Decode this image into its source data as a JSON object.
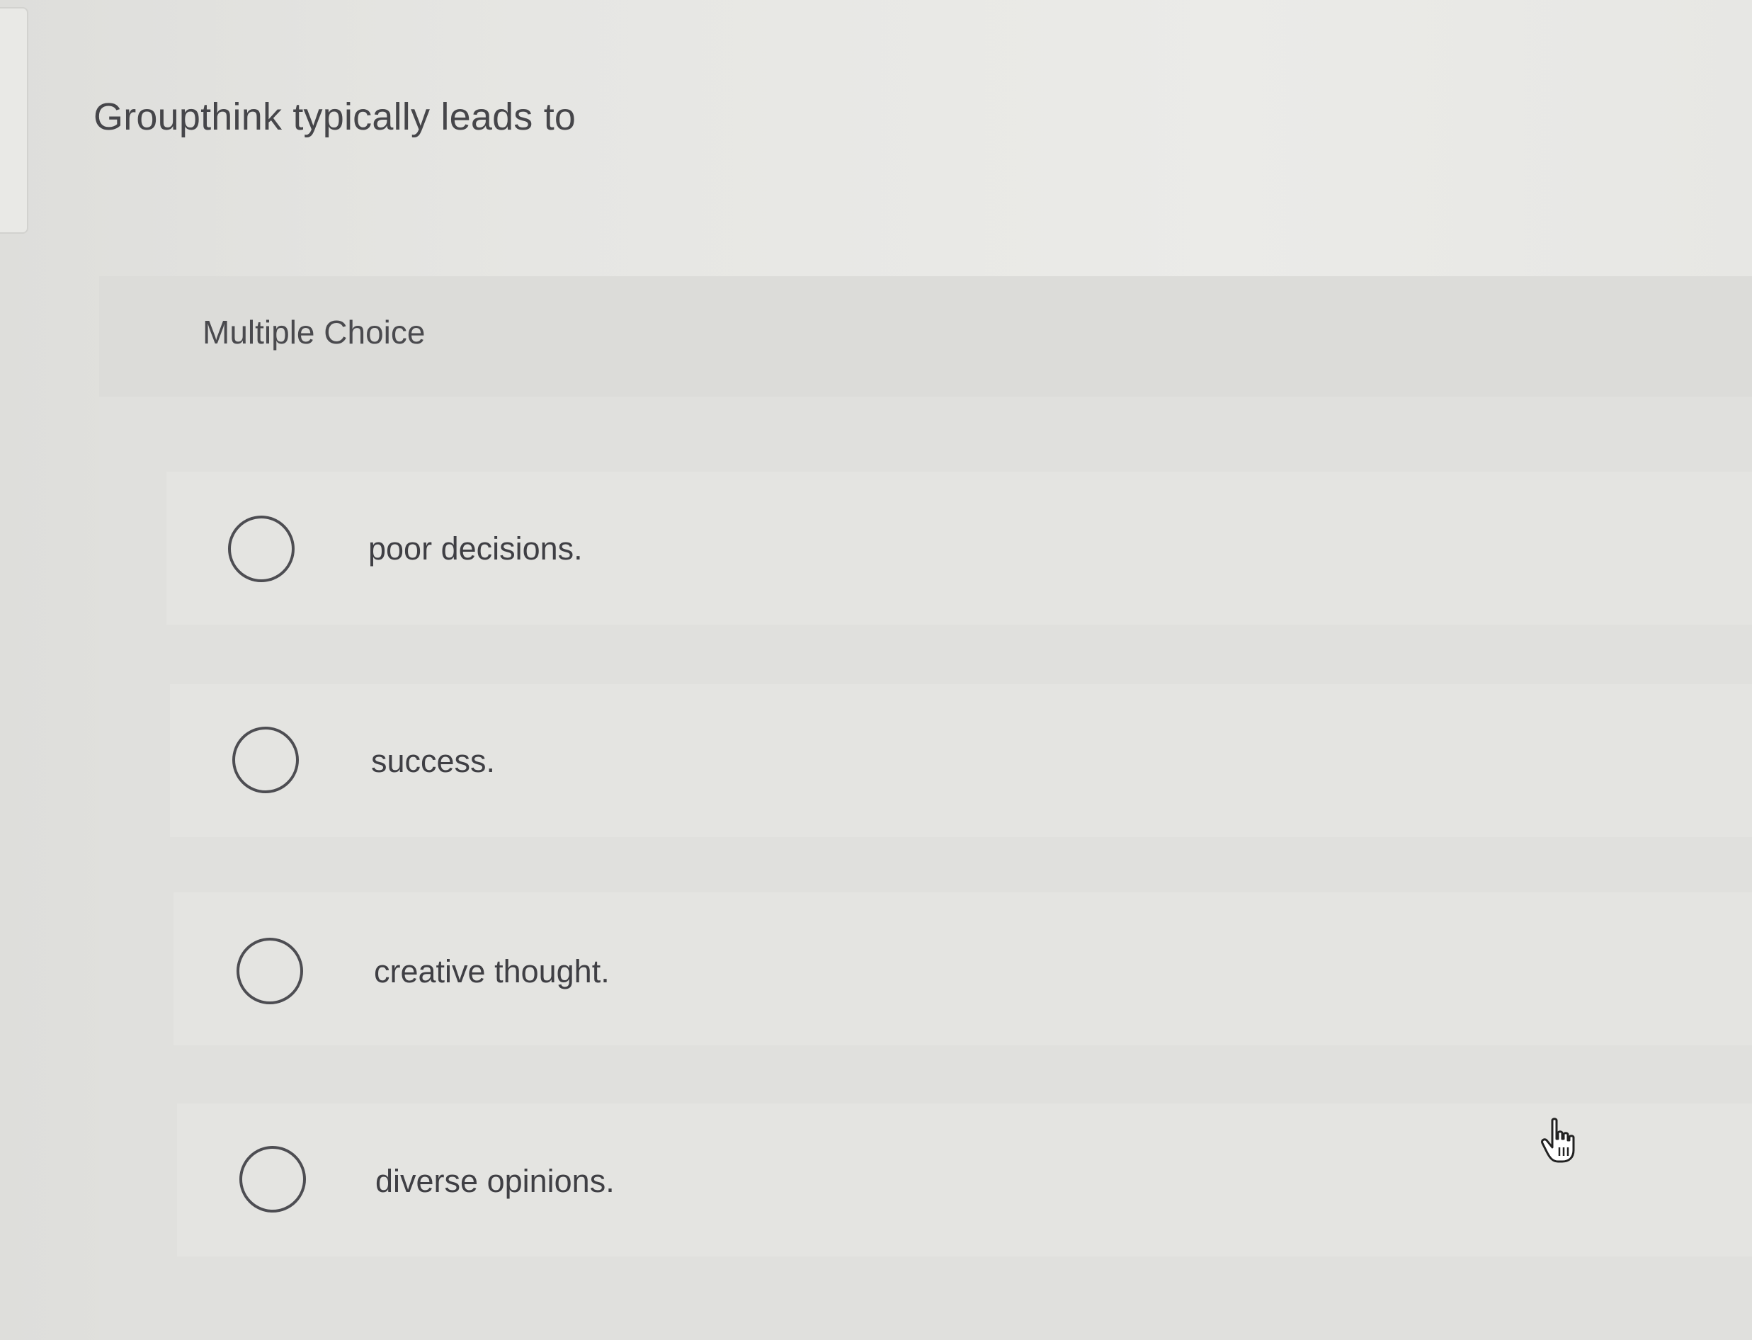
{
  "question": {
    "text": "Groupthink typically leads to"
  },
  "panel": {
    "title": "Multiple Choice"
  },
  "options": [
    {
      "label": "poor decisions.",
      "selected": false
    },
    {
      "label": "success.",
      "selected": false
    },
    {
      "label": "creative thought.",
      "selected": false
    },
    {
      "label": "diverse opinions.",
      "selected": false
    }
  ],
  "colors": {
    "background": "#e3e3e0",
    "text": "#46464a",
    "radio_border": "#4d4d52"
  },
  "icons": {
    "cursor": "hand-pointer-icon",
    "radio": "radio-unchecked-icon"
  }
}
